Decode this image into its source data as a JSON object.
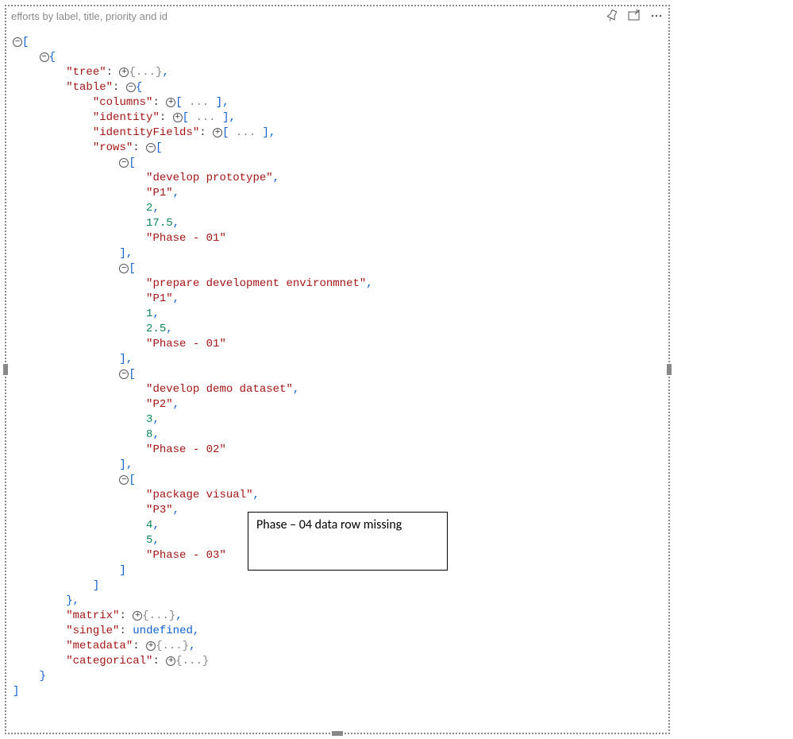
{
  "header": {
    "title": "efforts by label, title, priority and id"
  },
  "annotation": "Phase – 04 data row missing",
  "glyph": {
    "collapsed": "+",
    "expanded": "−"
  },
  "json": {
    "table": {
      "rows": [
        [
          "develop prototype",
          "P1",
          2,
          17.5,
          "Phase - 01"
        ],
        [
          "prepare development environmnet",
          "P1",
          1,
          2.5,
          "Phase - 01"
        ],
        [
          "develop demo dataset",
          "P2",
          3,
          8,
          "Phase - 02"
        ],
        [
          "package visual",
          "P3",
          4,
          5,
          "Phase - 03"
        ]
      ]
    },
    "keys": {
      "tree": "tree",
      "table": "table",
      "columns": "columns",
      "identity": "identity",
      "identityFields": "identityFields",
      "rows": "rows",
      "matrix": "matrix",
      "single": "single",
      "metadata": "metadata",
      "categorical": "categorical"
    },
    "vals": {
      "undefined": "undefined",
      "objEllip": "{...}",
      "arrEllipOpen": "[",
      "arrEllipMid": " ... ",
      "arrEllipClose": "]"
    }
  }
}
